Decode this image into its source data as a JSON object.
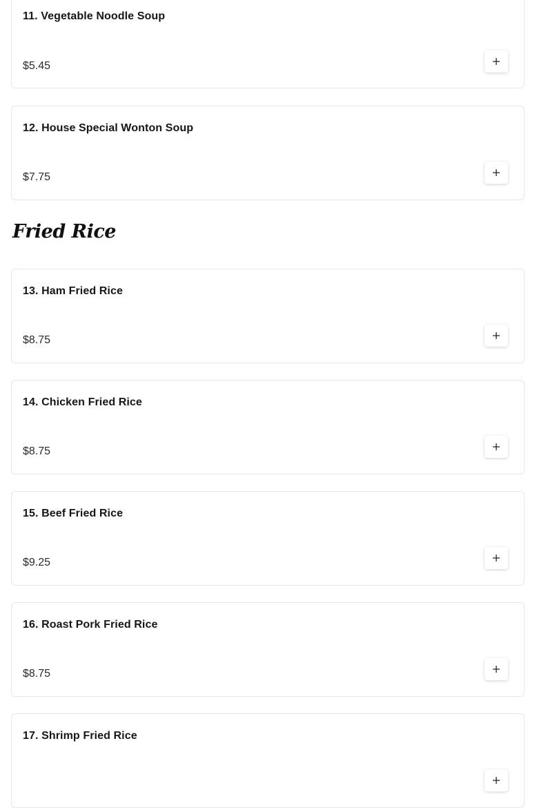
{
  "sections": [
    {
      "title": "",
      "items": [
        {
          "name": "11. Vegetable Noodle Soup",
          "price": "$5.45",
          "add_icon": "plus-icon"
        },
        {
          "name": "12. House Special Wonton Soup",
          "price": "$7.75",
          "add_icon": "plus-icon"
        }
      ]
    },
    {
      "title": "Fried Rice",
      "items": [
        {
          "name": "13. Ham Fried Rice",
          "price": "$8.75",
          "add_icon": "plus-icon"
        },
        {
          "name": "14. Chicken Fried Rice",
          "price": "$8.75",
          "add_icon": "plus-icon"
        },
        {
          "name": "15. Beef Fried Rice",
          "price": "$9.25",
          "add_icon": "plus-icon"
        },
        {
          "name": "16. Roast Pork Fried Rice",
          "price": "$8.75",
          "add_icon": "plus-icon"
        },
        {
          "name": "17. Shrimp Fried Rice",
          "price": "",
          "add_icon": "plus-icon"
        }
      ]
    }
  ],
  "colors": {
    "text": "#111111",
    "card_border": "#e7e7e7",
    "background": "#ffffff"
  }
}
